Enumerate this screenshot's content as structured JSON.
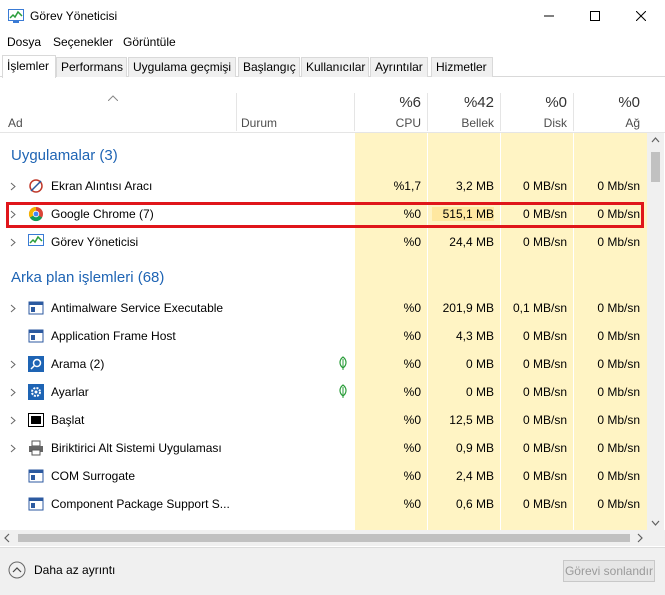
{
  "window": {
    "title": "Görev Yöneticisi"
  },
  "menu": [
    "Dosya",
    "Seçenekler",
    "Görüntüle"
  ],
  "tabs": [
    "İşlemler",
    "Performans",
    "Uygulama geçmişi",
    "Başlangıç",
    "Kullanıcılar",
    "Ayrıntılar",
    "Hizmetler"
  ],
  "columns": {
    "name": "Ad",
    "status": "Durum",
    "cpu": {
      "pct": "%6",
      "label": "CPU"
    },
    "memory": {
      "pct": "%42",
      "label": "Bellek"
    },
    "disk": {
      "pct": "%0",
      "label": "Disk"
    },
    "network": {
      "pct": "%0",
      "label": "Ağ"
    }
  },
  "groups": {
    "apps": "Uygulamalar (3)",
    "background": "Arka plan işlemleri (68)"
  },
  "apps": [
    {
      "name": "Ekran Alıntısı Aracı",
      "cpu": "%1,7",
      "memory": "3,2 MB",
      "disk": "0 MB/sn",
      "network": "0 Mb/sn",
      "icon": "snipping-tool-icon"
    },
    {
      "name": "Google Chrome (7)",
      "cpu": "%0",
      "memory": "515,1 MB",
      "disk": "0 MB/sn",
      "network": "0 Mb/sn",
      "icon": "chrome-icon"
    },
    {
      "name": "Görev Yöneticisi",
      "cpu": "%0",
      "memory": "24,4 MB",
      "disk": "0 MB/sn",
      "network": "0 Mb/sn",
      "icon": "task-manager-icon"
    }
  ],
  "background": [
    {
      "name": "Antimalware Service Executable",
      "cpu": "%0",
      "memory": "201,9 MB",
      "disk": "0,1 MB/sn",
      "network": "0 Mb/sn"
    },
    {
      "name": "Application Frame Host",
      "cpu": "%0",
      "memory": "4,3 MB",
      "disk": "0 MB/sn",
      "network": "0 Mb/sn"
    },
    {
      "name": "Arama (2)",
      "cpu": "%0",
      "memory": "0 MB",
      "disk": "0 MB/sn",
      "network": "0 Mb/sn"
    },
    {
      "name": "Ayarlar",
      "cpu": "%0",
      "memory": "0 MB",
      "disk": "0 MB/sn",
      "network": "0 Mb/sn"
    },
    {
      "name": "Başlat",
      "cpu": "%0",
      "memory": "12,5 MB",
      "disk": "0 MB/sn",
      "network": "0 Mb/sn"
    },
    {
      "name": "Biriktirici Alt Sistemi Uygulaması",
      "cpu": "%0",
      "memory": "0,9 MB",
      "disk": "0 MB/sn",
      "network": "0 Mb/sn"
    },
    {
      "name": "COM Surrogate",
      "cpu": "%0",
      "memory": "2,4 MB",
      "disk": "0 MB/sn",
      "network": "0 Mb/sn"
    },
    {
      "name": "Component Package Support S...",
      "cpu": "%0",
      "memory": "0,6 MB",
      "disk": "0 MB/sn",
      "network": "0 Mb/sn"
    }
  ],
  "footer": {
    "less_details": "Daha az ayrıntı",
    "end_task": "Görevi sonlandır"
  },
  "colors": {
    "group_header": "#1e64b4",
    "cell_highlight": "#fff4c4",
    "annotation_box": "#e0161b"
  }
}
